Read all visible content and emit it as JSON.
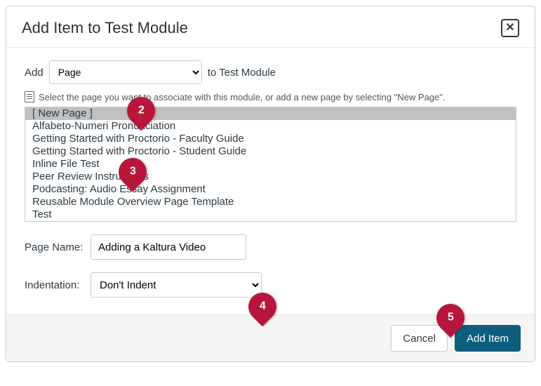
{
  "header": {
    "title": "Add Item to Test Module"
  },
  "addRow": {
    "prefix": "Add",
    "selected": "Page",
    "suffix": "to Test Module"
  },
  "helper": "Select the page you want to associate with this module, or add a new page by selecting \"New Page\".",
  "pages": [
    "[ New Page ]",
    "Alfabeto-Numeri Pronunciation",
    "Getting Started with Proctorio - Faculty Guide",
    "Getting Started with Proctorio - Student Guide",
    "Inline File Test",
    "Peer Review Instructions",
    "Podcasting: Audio Essay Assignment",
    "Reusable Module Overview Page Template",
    "Test"
  ],
  "pageName": {
    "label": "Page Name:",
    "value": "Adding a Kaltura Video"
  },
  "indentation": {
    "label": "Indentation:",
    "selected": "Don't Indent"
  },
  "footer": {
    "cancel": "Cancel",
    "submit": "Add Item"
  },
  "callouts": {
    "c2": "2",
    "c3": "3",
    "c4": "4",
    "c5": "5"
  }
}
